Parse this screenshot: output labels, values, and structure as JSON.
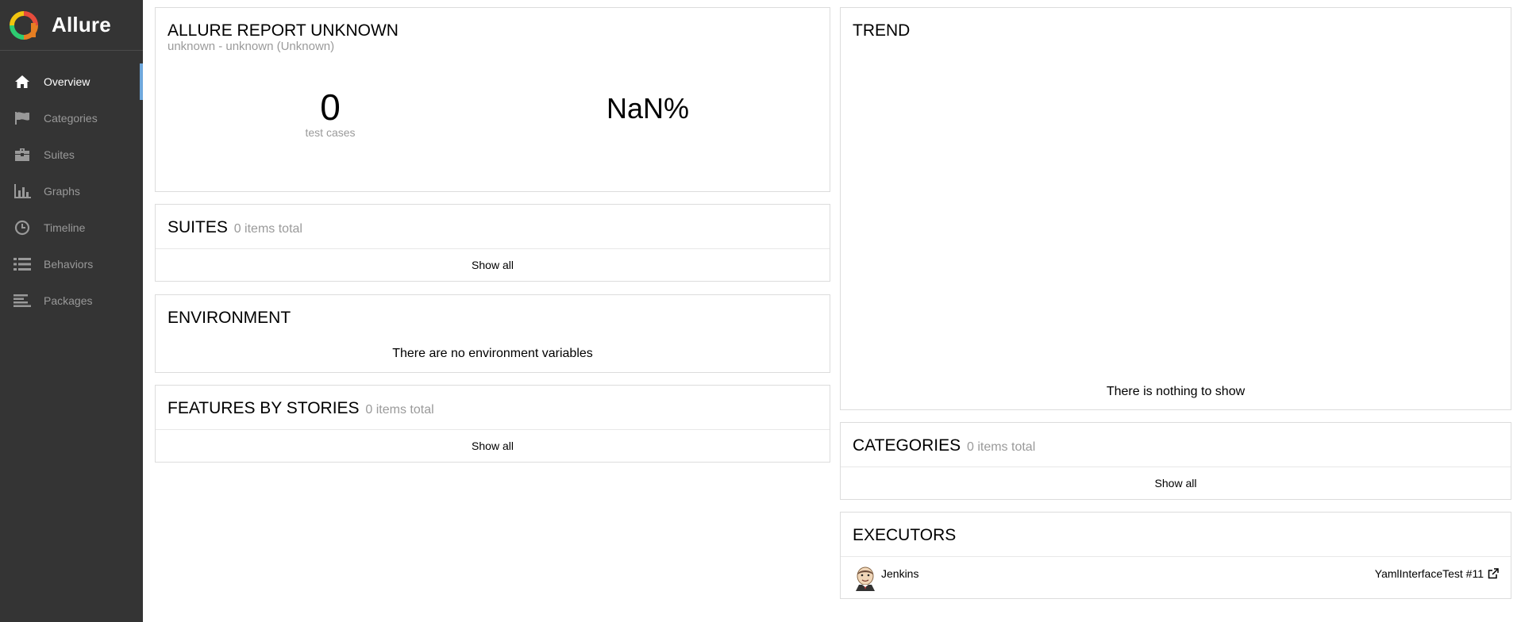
{
  "brand": {
    "name": "Allure"
  },
  "sidebar": {
    "items": [
      {
        "label": "Overview",
        "icon": "home-icon",
        "active": true
      },
      {
        "label": "Categories",
        "icon": "flag-icon"
      },
      {
        "label": "Suites",
        "icon": "briefcase-icon"
      },
      {
        "label": "Graphs",
        "icon": "bar-chart-icon"
      },
      {
        "label": "Timeline",
        "icon": "clock-icon"
      },
      {
        "label": "Behaviors",
        "icon": "list-icon"
      },
      {
        "label": "Packages",
        "icon": "align-left-icon"
      }
    ]
  },
  "summary": {
    "title": "ALLURE REPORT UNKNOWN",
    "subtitle": "unknown - unknown (Unknown)",
    "test_count": "0",
    "test_count_label": "test cases",
    "percent": "NaN%"
  },
  "suites": {
    "title": "SUITES",
    "count": "0 items total",
    "show_all": "Show all"
  },
  "environment": {
    "title": "ENVIRONMENT",
    "message": "There are no environment variables"
  },
  "features": {
    "title": "FEATURES BY STORIES",
    "count": "0 items total",
    "show_all": "Show all"
  },
  "trend": {
    "title": "TREND",
    "message": "There is nothing to show"
  },
  "categories": {
    "title": "CATEGORIES",
    "count": "0 items total",
    "show_all": "Show all"
  },
  "executors": {
    "title": "EXECUTORS",
    "name": "Jenkins",
    "build": "YamlInterfaceTest #11"
  },
  "colors": {
    "sidebar_bg": "#343434",
    "active_marker": "#6fa8dc",
    "muted_text": "#9a9a9a"
  }
}
